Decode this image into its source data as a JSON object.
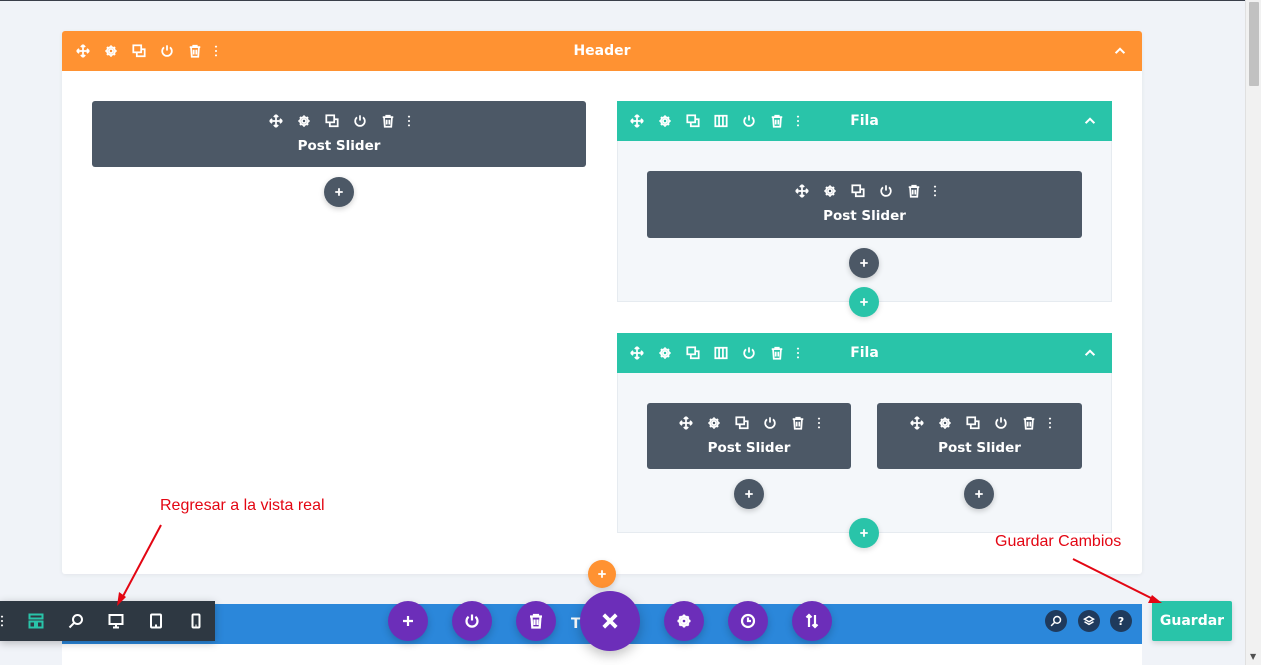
{
  "section": {
    "title": "Header"
  },
  "left_module": {
    "title": "Post Slider"
  },
  "rows": [
    {
      "title": "Fila",
      "modules": [
        {
          "title": "Post Slider"
        }
      ]
    },
    {
      "title": "Fila",
      "modules": [
        {
          "title": "Post Slider"
        },
        {
          "title": "Post Slider"
        }
      ]
    }
  ],
  "blue_section": {
    "title_visible": "T"
  },
  "save_button": {
    "label": "Guardar"
  },
  "annotations": {
    "back_to_view": "Regresar a la vista real",
    "save_changes": "Guardar Cambios"
  },
  "colors": {
    "section_header": "#ff9232",
    "row_header": "#29c4a9",
    "module": "#4c5866",
    "purple_buttons": "#6c2eb9",
    "blue_section": "#2b87da",
    "dock": "#2e3842",
    "annotation": "#e30613"
  },
  "icons": {
    "module_toolbar": [
      "move-icon",
      "gear-icon",
      "duplicate-icon",
      "power-icon",
      "trash-icon",
      "more-icon"
    ],
    "row_toolbar": [
      "move-icon",
      "gear-icon",
      "duplicate-icon",
      "columns-icon",
      "power-icon",
      "trash-icon",
      "more-icon"
    ],
    "bottom_bar": [
      "plus-icon",
      "power-icon",
      "trash-icon",
      "close-icon",
      "gear-icon",
      "history-icon",
      "sort-icon"
    ],
    "dock": [
      "more-icon",
      "wireframe-icon",
      "zoom-icon",
      "desktop-icon",
      "tablet-icon",
      "phone-icon"
    ],
    "right_tools": [
      "search-icon",
      "layers-icon",
      "help-icon"
    ]
  }
}
